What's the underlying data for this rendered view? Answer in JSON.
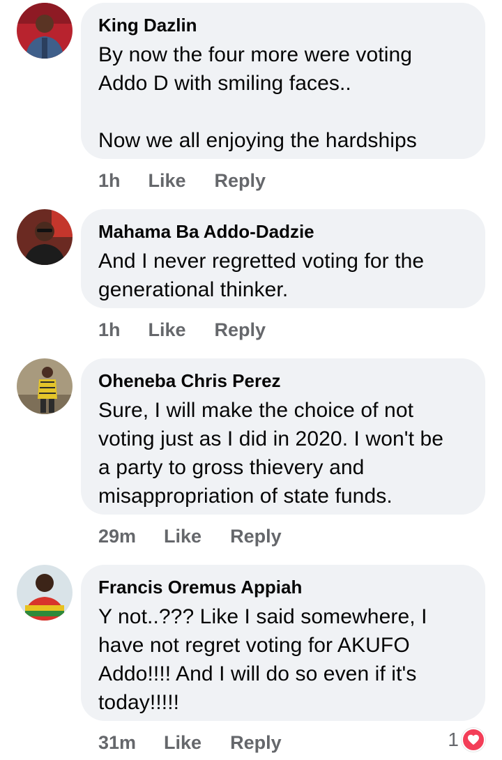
{
  "comments": [
    {
      "author": "King Dazlin",
      "text": "By now the four more were voting\nAddo D with smiling faces..\n\nNow we all enjoying the hardships",
      "time": "1h",
      "like_label": "Like",
      "reply_label": "Reply"
    },
    {
      "author": "Mahama Ba Addo-Dadzie",
      "text": "And I never regretted voting for the\ngenerational thinker.",
      "time": "1h",
      "like_label": "Like",
      "reply_label": "Reply"
    },
    {
      "author": "Oheneba Chris Perez",
      "text": "Sure, I will make the choice of not\nvoting just as I did in 2020. I won't be\na party to gross thievery and\nmisappropriation of state funds.",
      "time": "29m",
      "like_label": "Like",
      "reply_label": "Reply"
    },
    {
      "author": "Francis Oremus Appiah",
      "text": "Y not..??? Like I said somewhere, I\nhave not regret voting for AKUFO\nAddo!!!! And I will do so even if it's\ntoday!!!!!",
      "time": "31m",
      "like_label": "Like",
      "reply_label": "Reply",
      "reaction_count": "1",
      "reaction_icon": "heart-icon",
      "reaction_color": "#f33e58"
    }
  ]
}
